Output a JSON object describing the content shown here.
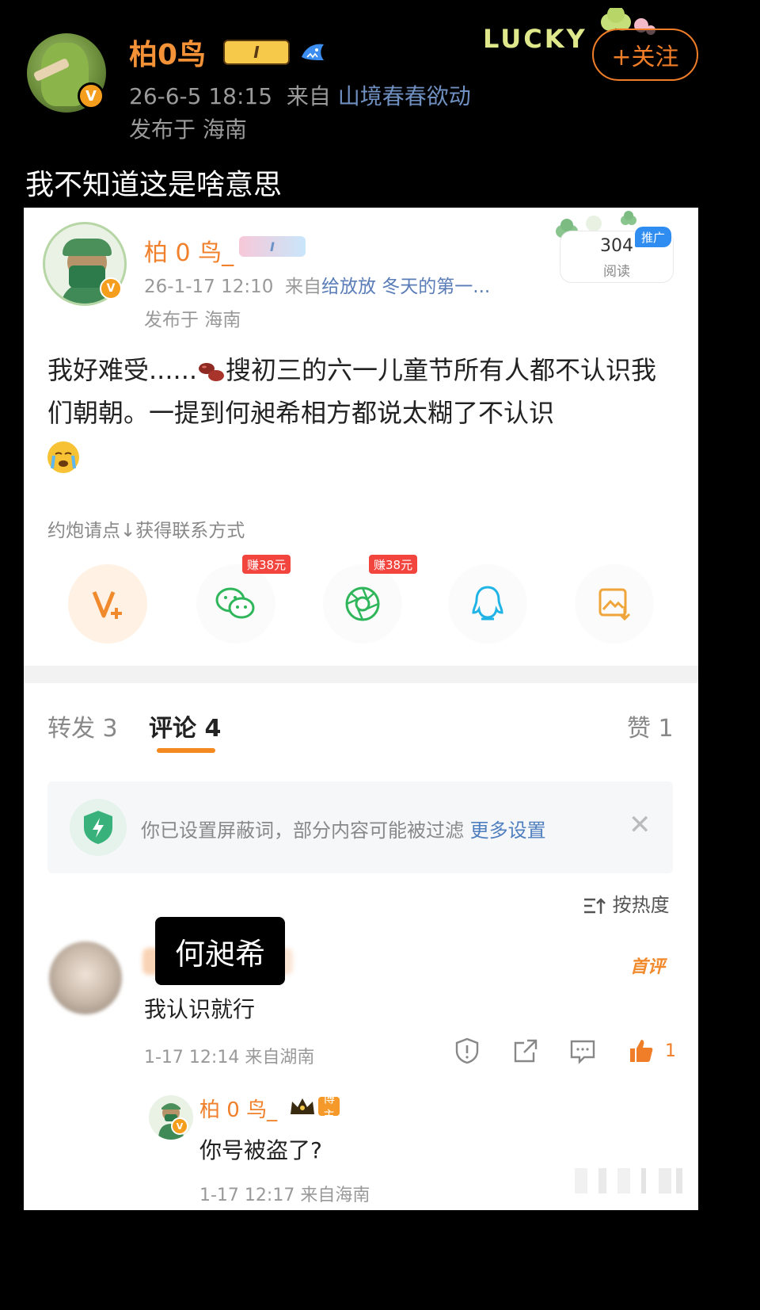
{
  "outer": {
    "username": "柏0鸟",
    "level_badge": "I",
    "timestamp": "26-6-5 18:15",
    "from_prefix": "来自",
    "source": "山境春春欲动",
    "location": "发布于 海南",
    "follow_label": "+关注",
    "deco_text": "LUCKY",
    "post_text": "我不知道这是啥意思"
  },
  "card": {
    "username": "柏 0 鸟_",
    "level_badge": "I",
    "timestamp": "26-1-17 12:10",
    "from_prefix": "来自",
    "source": "给放放  冬天的第一...",
    "location": "发布于 海南",
    "views": "304",
    "views_label": "阅读",
    "promo_label": "推广",
    "text_part1": "我好难受......",
    "text_part2": "搜初三的六一儿童节所有人都不认识我们朝朝。一提到何昶希相方都说太糊了不认识",
    "ad_line": "约炮请点↓获得联系方式",
    "share": {
      "reward_1": "赚38元",
      "reward_2": "赚38元"
    },
    "tabs": {
      "repost": "转发 3",
      "comment": "评论 4",
      "like": "赞 1"
    },
    "filter": {
      "text": "你已设置屏蔽词，部分内容可能被过滤",
      "more": "更多设置"
    },
    "sort_label": "按热度",
    "comment": {
      "overlay_name": "何昶希",
      "text": "我认识就行",
      "first_tag": "首评",
      "timestamp": "1-17 12:14",
      "from": "来自湖南",
      "likes": "1"
    },
    "reply": {
      "username": "柏 0 鸟_",
      "owner_tag": "博主",
      "text": "你号被盗了?",
      "timestamp": "1-17 12:17",
      "from": "来自海南"
    }
  },
  "colors": {
    "accent_orange": "#f0802b",
    "link_blue": "#5a7db8",
    "like_orange": "#f07d27"
  },
  "icons": [
    "shark-icon",
    "clover-icon",
    "verified-icon",
    "v-plus-icon",
    "wechat-icon",
    "moments-icon",
    "qq-icon",
    "save-image-icon",
    "shield-icon",
    "close-icon",
    "sort-icon",
    "report-icon",
    "share-icon",
    "comment-icon",
    "like-icon",
    "crown-icon"
  ]
}
